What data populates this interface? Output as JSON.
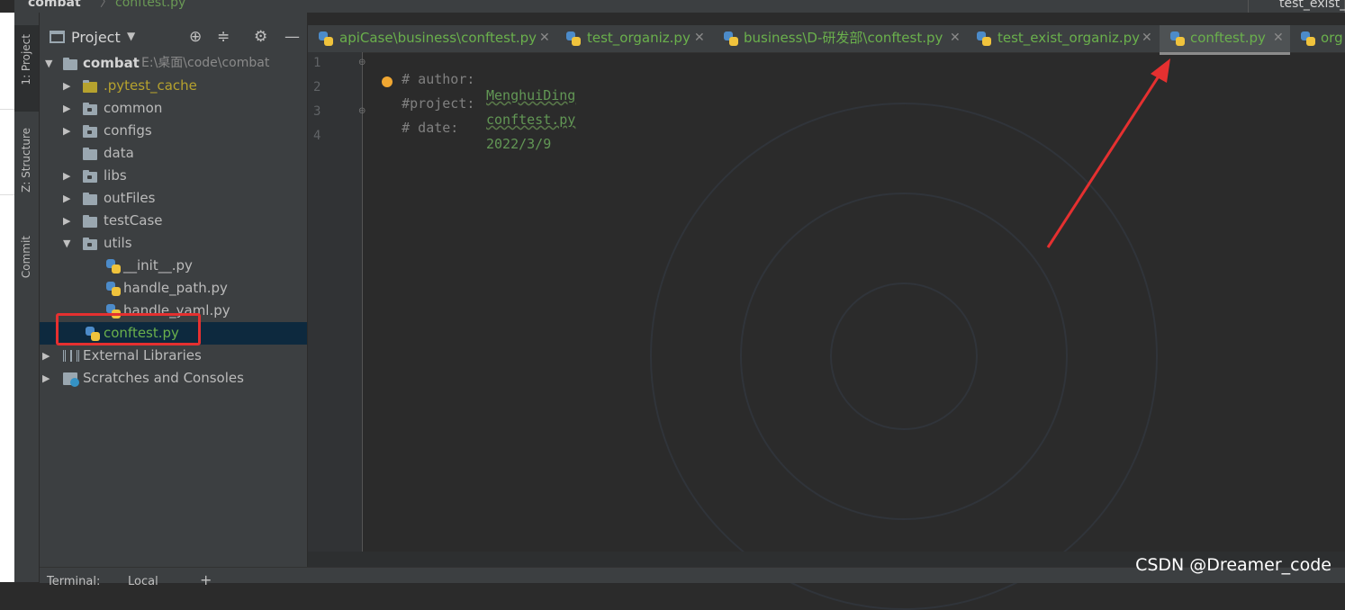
{
  "breadcrumb": {
    "root": "combat",
    "separator": "〉",
    "file": "conftest.py"
  },
  "right_top_tab": "test_exist_",
  "tool_window_stripe": [
    "1: Project",
    "Z: Structure",
    "Commit"
  ],
  "project_panel": {
    "title": "Project",
    "dropdown_icon": "chevron-down-icon",
    "tools": [
      "locate-icon",
      "collapse-icon",
      "gear-icon",
      "minimize-icon"
    ]
  },
  "tree": [
    {
      "label": "combat",
      "hint": "E:\\桌面\\code\\combat",
      "type": "folder",
      "expanded": true
    },
    {
      "label": ".pytest_cache",
      "type": "folder",
      "color": "#b6a22e"
    },
    {
      "label": "common",
      "type": "package"
    },
    {
      "label": "configs",
      "type": "package"
    },
    {
      "label": "data",
      "type": "folder"
    },
    {
      "label": "libs",
      "type": "package"
    },
    {
      "label": "outFiles",
      "type": "folder"
    },
    {
      "label": "testCase",
      "type": "folder"
    },
    {
      "label": "utils",
      "type": "package",
      "expanded": true
    },
    {
      "label": "__init__.py",
      "type": "python"
    },
    {
      "label": "handle_path.py",
      "type": "python"
    },
    {
      "label": "handle_yaml.py",
      "type": "python"
    },
    {
      "label": "conftest.py",
      "type": "python",
      "color": "#6ab04c",
      "selected": true
    },
    {
      "label": "External Libraries",
      "type": "library"
    },
    {
      "label": "Scratches and Consoles",
      "type": "scratch"
    }
  ],
  "tabs": [
    {
      "label": "apiCase\\business\\conftest.py"
    },
    {
      "label": "test_organiz.py"
    },
    {
      "label": "business\\D-研发部\\conftest.py"
    },
    {
      "label": "test_exist_organiz.py"
    },
    {
      "label": "conftest.py",
      "active": true
    },
    {
      "label": "org"
    }
  ],
  "editor": {
    "line_numbers": [
      "1",
      "2",
      "3",
      "4"
    ],
    "lines": [
      {
        "key": "# author:",
        "value": "MenghuiDing"
      },
      {
        "key": "#project:",
        "value": "conftest.py"
      },
      {
        "key": "# date:",
        "value": "2022/3/9"
      },
      {
        "key": "",
        "value": ""
      }
    ]
  },
  "bottom_bar": {
    "terminal": "Terminal:",
    "local": "Local",
    "add": "+"
  },
  "watermark": "CSDN @Dreamer_code",
  "colors": {
    "annotation": "#e53030",
    "active_file": "#6ab04c",
    "selection": "#0d293e"
  }
}
